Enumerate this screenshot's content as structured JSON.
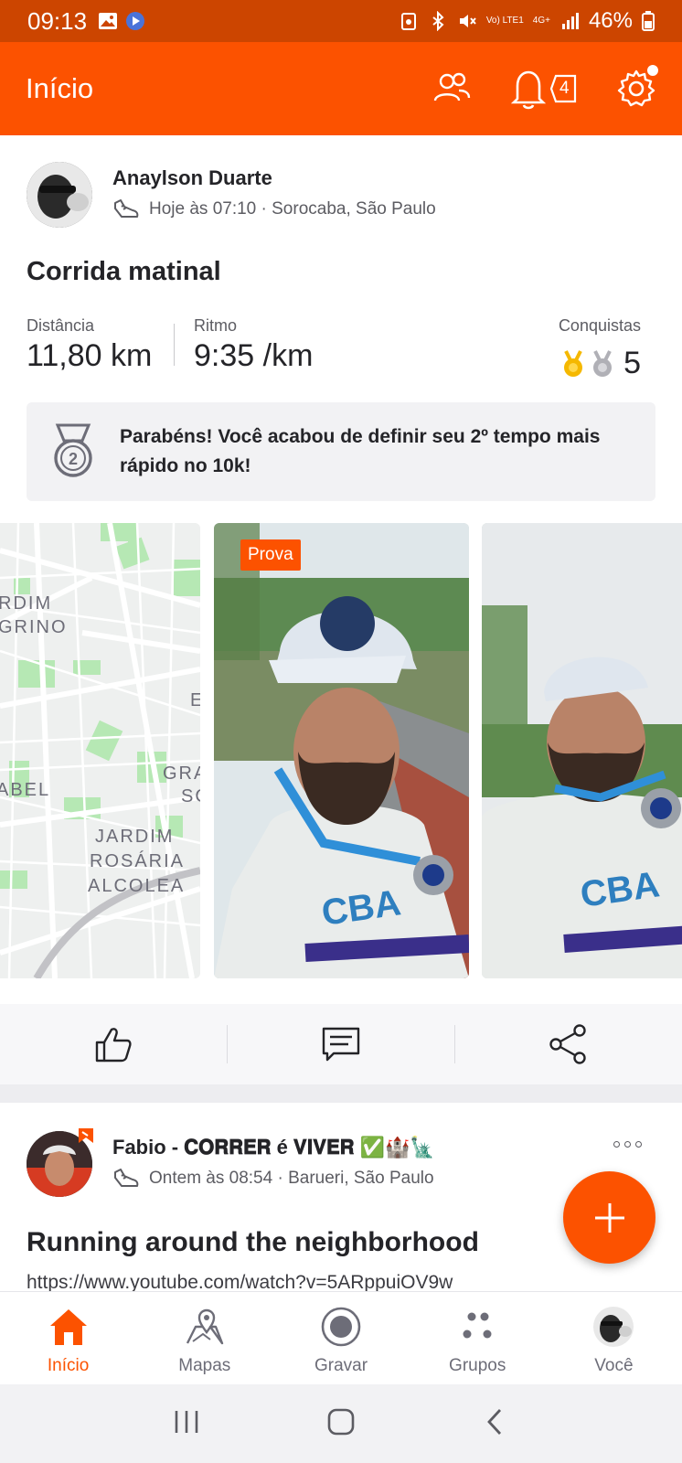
{
  "status_bar": {
    "time": "09:13",
    "battery": "46%",
    "network": "Vo) LTE1",
    "network_type": "4G+"
  },
  "app_bar": {
    "title": "Início",
    "notification_count": "4"
  },
  "activity": {
    "athlete_name": "Anaylson Duarte",
    "meta": "Hoje às 07:10 · Sorocaba, São Paulo",
    "title": "Corrida matinal",
    "stats": {
      "distance_label": "Distância",
      "distance_value": "11,80 km",
      "pace_label": "Ritmo",
      "pace_value": "9:35 /km",
      "achievements_label": "Conquistas",
      "achievements_value": "5"
    },
    "highlight": "Parabéns! Você acabou de definir seu 2º tempo mais rápido no 10k!",
    "photo_tag": "Prova",
    "map_labels": [
      "RDIM",
      "GRINO",
      "ABEL",
      "E",
      "GRA",
      "SC",
      "JARDIM",
      "ROSÁRIA",
      "ALCOLEA"
    ]
  },
  "next_post": {
    "athlete_name": "Fabio - 𝐂𝐎𝐑𝐑𝐄𝐑 é 𝐕𝐈𝐕𝐄𝐑 ✅🏰🗽",
    "meta": "Ontem às 08:54 · Barueri, São Paulo",
    "title": "Running around the neighborhood",
    "link": "https://www.youtube.com/watch?v=5ARppuiOV9w"
  },
  "bottom_nav": [
    {
      "label": "Início",
      "icon": "home-icon",
      "active": true
    },
    {
      "label": "Mapas",
      "icon": "maps-icon",
      "active": false
    },
    {
      "label": "Gravar",
      "icon": "record-icon",
      "active": false
    },
    {
      "label": "Grupos",
      "icon": "groups-icon",
      "active": false
    },
    {
      "label": "Você",
      "icon": "profile-avatar",
      "active": false
    }
  ],
  "colors": {
    "brand": "#fc5200",
    "status_bar": "#cc4500",
    "text": "#242428",
    "muted": "#5c5c62"
  }
}
